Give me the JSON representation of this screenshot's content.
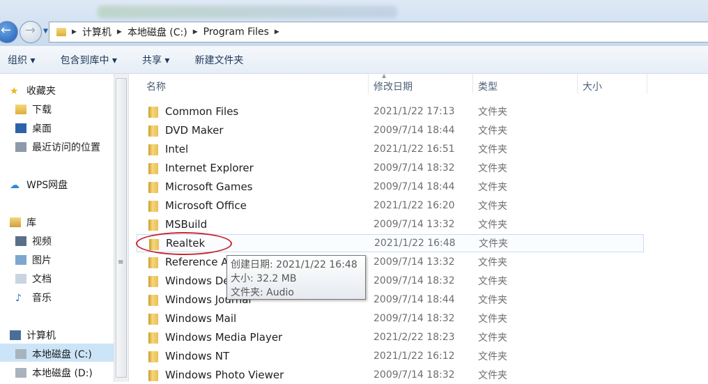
{
  "address": {
    "crumbs": [
      "计算机",
      "本地磁盘 (C:)",
      "Program Files"
    ]
  },
  "toolbar": {
    "organize": "组织 ▾",
    "include": "包含到库中 ▾",
    "share": "共享 ▾",
    "new_folder": "新建文件夹"
  },
  "sidebar": {
    "favorites": "收藏夹",
    "downloads": "下载",
    "desktop": "桌面",
    "recent": "最近访问的位置",
    "wps": "WPS网盘",
    "library": "库",
    "videos": "视频",
    "pictures": "图片",
    "docs": "文档",
    "music": "音乐",
    "computer": "计算机",
    "drive_c": "本地磁盘 (C:)",
    "drive_d": "本地磁盘 (D:)"
  },
  "columns": {
    "name": "名称",
    "date": "修改日期",
    "type": "类型",
    "size": "大小"
  },
  "files": [
    {
      "name": "Common Files",
      "date": "2021/1/22 17:13",
      "type": "文件夹"
    },
    {
      "name": "DVD Maker",
      "date": "2009/7/14 18:44",
      "type": "文件夹"
    },
    {
      "name": "Intel",
      "date": "2021/1/22 16:51",
      "type": "文件夹"
    },
    {
      "name": "Internet Explorer",
      "date": "2009/7/14 18:32",
      "type": "文件夹"
    },
    {
      "name": "Microsoft Games",
      "date": "2009/7/14 18:44",
      "type": "文件夹"
    },
    {
      "name": "Microsoft Office",
      "date": "2021/1/22 16:20",
      "type": "文件夹"
    },
    {
      "name": "MSBuild",
      "date": "2009/7/14 13:32",
      "type": "文件夹"
    },
    {
      "name": "Realtek",
      "date": "2021/1/22 16:48",
      "type": "文件夹"
    },
    {
      "name": "Reference A",
      "date": "2009/7/14 13:32",
      "type": "文件夹"
    },
    {
      "name": "Windows De",
      "date": "2009/7/14 18:32",
      "type": "文件夹"
    },
    {
      "name": "Windows Journal",
      "date": "2009/7/14 18:44",
      "type": "文件夹"
    },
    {
      "name": "Windows Mail",
      "date": "2009/7/14 18:32",
      "type": "文件夹"
    },
    {
      "name": "Windows Media Player",
      "date": "2021/2/22 18:23",
      "type": "文件夹"
    },
    {
      "name": "Windows NT",
      "date": "2021/1/22 16:12",
      "type": "文件夹"
    },
    {
      "name": "Windows Photo Viewer",
      "date": "2009/7/14 18:32",
      "type": "文件夹"
    }
  ],
  "tooltip": {
    "created": "创建日期: 2021/1/22 16:48",
    "size": "大小: 32.2 MB",
    "folders": "文件夹: Audio"
  }
}
